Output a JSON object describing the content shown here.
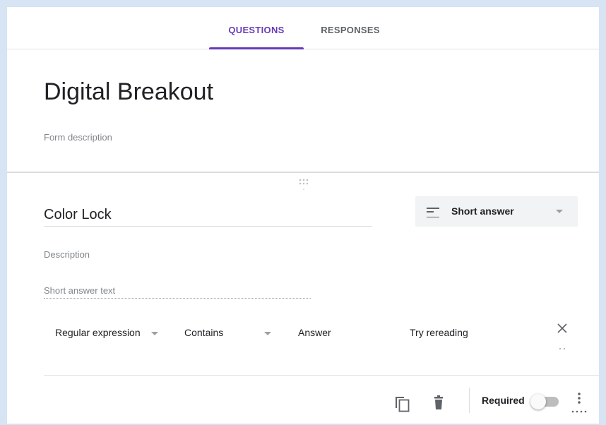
{
  "tabs": {
    "questions": "QUESTIONS",
    "responses": "RESPONSES"
  },
  "form": {
    "title": "Digital Breakout",
    "description_placeholder": "Form description"
  },
  "question": {
    "title": "Color Lock",
    "type": "Short answer",
    "description_placeholder": "Description",
    "answer_placeholder": "Short answer text"
  },
  "validation": {
    "kind": "Regular expression",
    "condition": "Contains",
    "pattern_placeholder": "Answer",
    "error_text": "Try rereading"
  },
  "footer": {
    "required_label": "Required",
    "required": false
  },
  "colors": {
    "accent": "#673ab7",
    "background": "#d6e4f4"
  },
  "icons": [
    "drag-handle-icon",
    "short-answer-icon",
    "chevron-down-icon",
    "close-icon",
    "duplicate-icon",
    "delete-icon",
    "more-vert-icon"
  ]
}
